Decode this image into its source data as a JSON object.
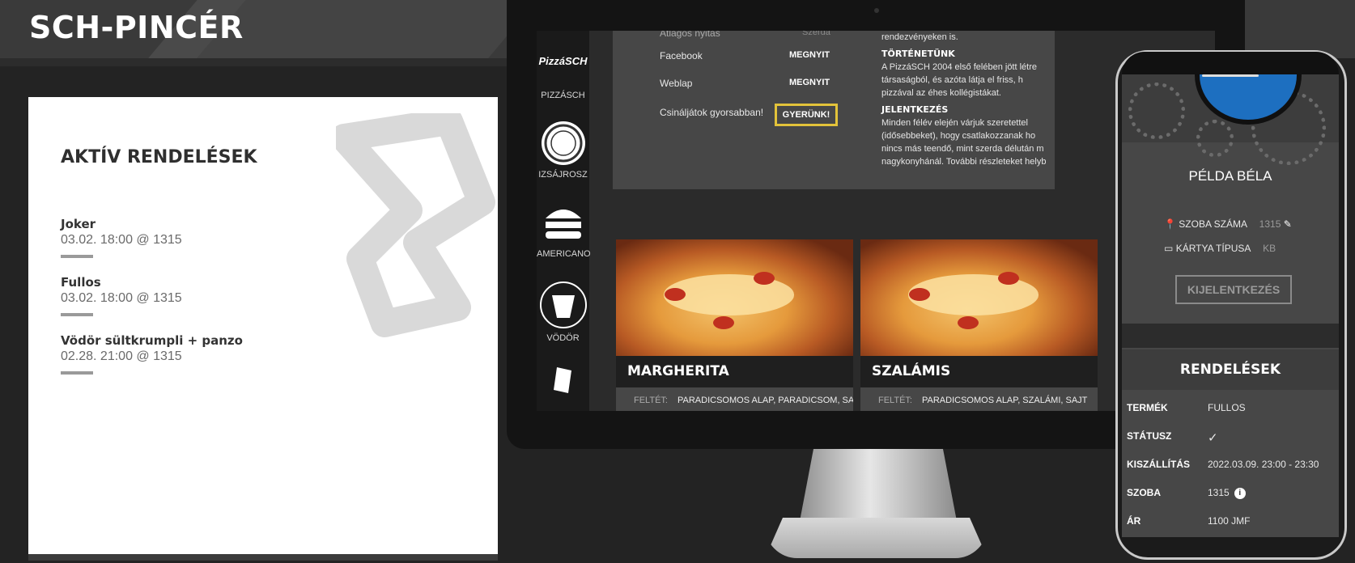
{
  "header": {
    "brand": "SCH-PINCÉR"
  },
  "orders_card": {
    "title": "AKTÍV RENDELÉSEK",
    "orders": [
      {
        "name": "Joker",
        "meta": "03.02. 18:00 @ 1315"
      },
      {
        "name": "Fullos",
        "meta": "03.02. 18:00 @ 1315"
      },
      {
        "name": "Vödör sültkrumpli + panzo",
        "meta": "02.28. 21:00 @ 1315"
      }
    ]
  },
  "monitor": {
    "nav": [
      {
        "label": "PIZZÁSCH",
        "icon": "PizzáSCH"
      },
      {
        "label": "IZSÁJROSZ",
        "icon": "IZSÁJROSZ"
      },
      {
        "label": "AMERICANO",
        "icon": "AMERICANO"
      },
      {
        "label": "VÖDÖR",
        "icon": "VÖDÖR"
      }
    ],
    "logo_text": "PizzáSCH",
    "links": {
      "opening_label": "Átlagos nyitás",
      "opening_value": "Szerda",
      "facebook_label": "Facebook",
      "facebook_btn": "MEGNYIT",
      "web_label": "Weblap",
      "web_btn": "MEGNYIT",
      "cta_label": "Csináljátok gyorsabban!",
      "cta_btn": "GYERÜNK!"
    },
    "about": {
      "intro": "rendezvényeken is.",
      "history_title": "TÖRTÉNETÜNK",
      "history_text": "A PizzáSCH 2004 első felében jött létre társaságból, és azóta látja el friss, h pizzával az éhes kollégistákat.",
      "apply_title": "JELENTKEZÉS",
      "apply_text": "Minden félév elején várjuk szeretettel (idősebbeket), hogy csatlakozzanak ho nincs más teendő, mint szerda délután m nagykonyhánál. További részleteket helyb"
    },
    "pizzas": [
      {
        "name": "MARGHERITA",
        "label": "FELTÉT:",
        "toppings": "PARADICSOMOS ALAP, PARADICSOM, SAJT"
      },
      {
        "name": "SZALÁMIS",
        "label": "FELTÉT:",
        "toppings": "PARADICSOMOS ALAP, SZALÁMI, SAJT"
      }
    ]
  },
  "phone": {
    "user_name": "PÉLDA BÉLA",
    "room_label": "SZOBA SZÁMA",
    "room_value": "1315",
    "card_label": "KÁRTYA TÍPUSA",
    "card_value": "KB",
    "logout": "KIJELENTKEZÉS",
    "orders_title": "RENDELÉSEK",
    "order": {
      "product_label": "TERMÉK",
      "product": "FULLOS",
      "status_label": "STÁTUSZ",
      "status": "✓",
      "delivery_label": "KISZÁLLÍTÁS",
      "delivery": "2022.03.09. 23:00 - 23:30",
      "room_label": "SZOBA",
      "room": "1315",
      "price_label": "ÁR",
      "price": "1100 JMF"
    }
  }
}
